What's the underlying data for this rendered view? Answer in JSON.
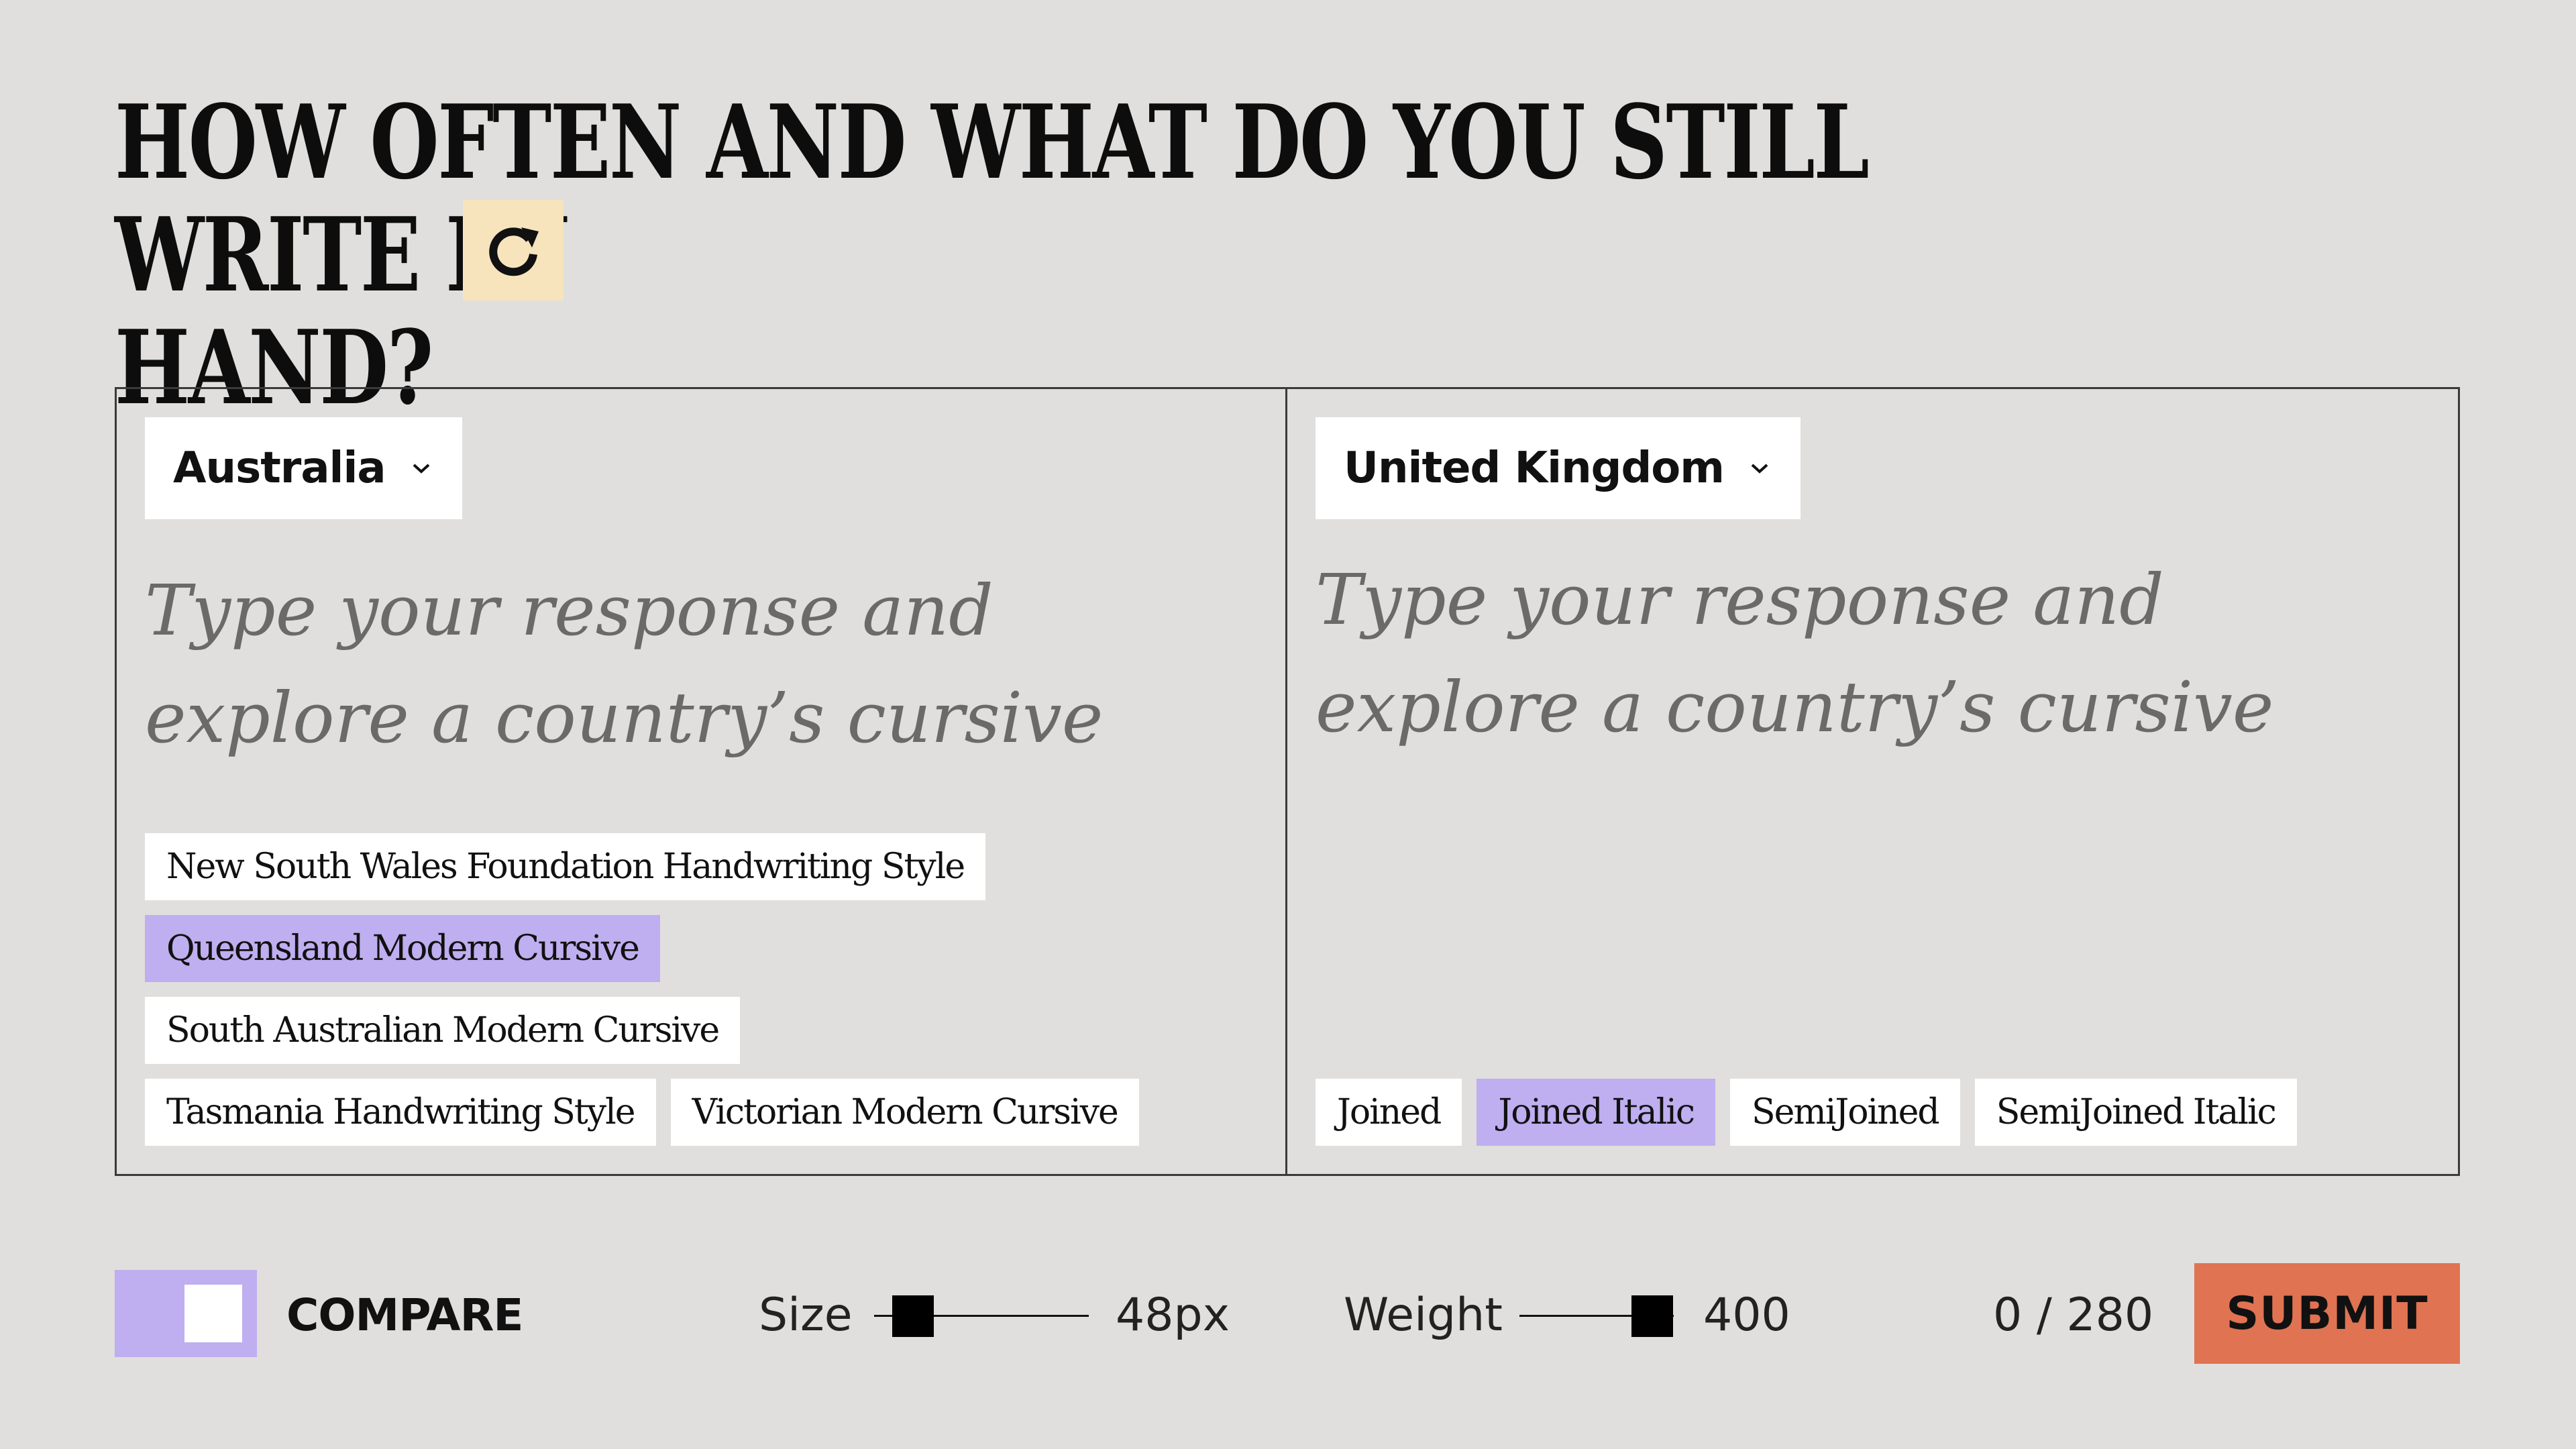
{
  "headline": "HOW OFTEN AND WHAT DO YOU STILL WRITE BY HAND?",
  "headline_line1": "HOW OFTEN AND WHAT DO YOU STILL WRITE BY",
  "headline_line2": "HAND?",
  "refresh_icon": "refresh-icon",
  "colors": {
    "background": "#e0dfdd",
    "accent_purple": "#bfaef0",
    "refresh_bg": "#f7e4bd",
    "submit_bg": "#e07352"
  },
  "left": {
    "country": "Australia",
    "placeholder": "Type your response and explore a country’s cursive style.",
    "styles": [
      {
        "label": "New South Wales Foundation Handwriting Style",
        "selected": false
      },
      {
        "label": "Queensland Modern Cursive",
        "selected": true
      },
      {
        "label": "South Australian Modern Cursive",
        "selected": false
      },
      {
        "label": "Tasmania Handwriting Style",
        "selected": false
      },
      {
        "label": "Victorian Modern Cursive",
        "selected": false
      }
    ]
  },
  "right": {
    "country": "United Kingdom",
    "placeholder": "Type your response and explore a country’s cursive style.",
    "styles": [
      {
        "label": "Joined",
        "selected": false
      },
      {
        "label": "Joined Italic",
        "selected": true
      },
      {
        "label": "SemiJoined",
        "selected": false
      },
      {
        "label": "SemiJoined Italic",
        "selected": false
      }
    ]
  },
  "toolbar": {
    "compare_label": "COMPARE",
    "compare_on": true,
    "size_label": "Size",
    "size_value": "48px",
    "size_level": 0.18,
    "weight_label": "Weight",
    "weight_value": "400",
    "weight_level": 0.86,
    "char_count": "0 / 280",
    "submit_label": "SUBMIT"
  }
}
